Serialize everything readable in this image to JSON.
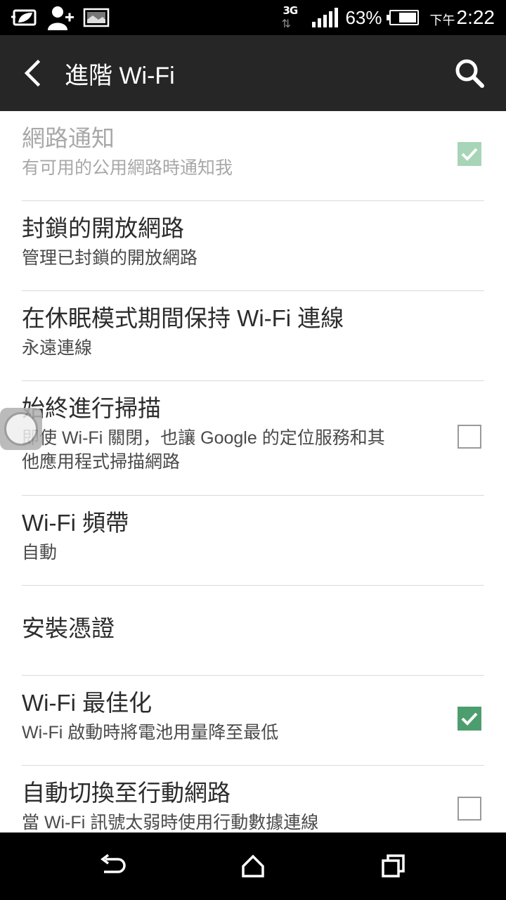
{
  "status_bar": {
    "network_type": "3G",
    "network_arrows": "⇅",
    "battery_percent": "63%",
    "battery_level": 0.63,
    "time_ampm": "下午",
    "time": "2:22",
    "left_icons": [
      "leaf-card-icon",
      "add-contact-icon",
      "image-icon"
    ]
  },
  "app_bar": {
    "title": "進階 Wi-Fi"
  },
  "settings": [
    {
      "title": "網路通知",
      "subtitle": "有可用的公用網路時通知我",
      "checkbox": true,
      "checked": true,
      "enabled": false
    },
    {
      "title": "封鎖的開放網路",
      "subtitle": "管理已封鎖的開放網路"
    },
    {
      "title": "在休眠模式期間保持 Wi-Fi 連線",
      "subtitle": "永遠連線"
    },
    {
      "title": "始終進行掃描",
      "subtitle_line1": "即使 Wi-Fi 關閉，也讓 Google 的定位服務和其",
      "subtitle_line2": "他應用程式掃描網路",
      "checkbox": true,
      "checked": false
    },
    {
      "title": "Wi-Fi 頻帶",
      "subtitle": "自動"
    },
    {
      "title": "安裝憑證"
    },
    {
      "title": "Wi-Fi 最佳化",
      "subtitle": "Wi-Fi 啟動時將電池用量降至最低",
      "checkbox": true,
      "checked": true
    },
    {
      "title": "自動切換至行動網路",
      "subtitle": "當 Wi-Fi 訊號太弱時使用行動數據連線",
      "checkbox": true,
      "checked": false
    }
  ],
  "colors": {
    "app_bar": "#262626",
    "checkbox_checked": "#4d9e6e",
    "checkbox_checked_disabled": "#a8d4b8"
  }
}
